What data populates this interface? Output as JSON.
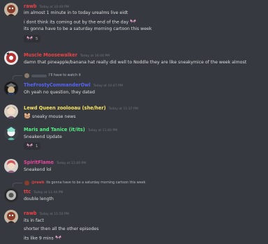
{
  "messages": [
    {
      "author": "rawb",
      "timestamp": "Today at 10:40 PM",
      "color": "#ed4245",
      "lines": [
        "im almost 1 minute in to today urealms live eidt",
        "i dont think its coming out by the end of the day",
        "its gonna have to be a saturday morning cartoon this week"
      ],
      "reaction": {
        "count": "5",
        "emoji": "butterfly-icon"
      }
    },
    {
      "author": "Muscle Moosewalker",
      "timestamp": "Today at 10:44 PM",
      "color": "#ed4245",
      "lines": [
        "damn that pineapple/banana hat really did well to Noddle they are like sneakymice of the week almost"
      ]
    },
    {
      "reply_preview": "I'll have to watch it",
      "author": "TheFrostyCommanderOwl",
      "timestamp": "Today at 10:47 PM",
      "color": "#5865f2",
      "lines": [
        "Oh yeah no question, they dated"
      ]
    },
    {
      "author": "Lewd Queen zoolooau (she/her)",
      "timestamp": "Today at 11:37 PM",
      "color": "#fee75c",
      "lines": [
        "sneaky mouse news"
      ]
    },
    {
      "author": "Maris and Tanice (it/its)",
      "timestamp": "Today at 11:40 PM",
      "color": "#57f287",
      "lines": [
        "Sneakend Update"
      ],
      "reaction": {
        "count": "1",
        "emoji": "butterfly-icon"
      }
    },
    {
      "author": "SpiritFlame",
      "timestamp": "Today at 11:40 PM",
      "color": "#eb459e",
      "lines": [
        "Sneakend lol"
      ]
    },
    {
      "reply_author": "@rawb",
      "reply_preview": "its gonna have to be a saturday morning cartoon this week",
      "author": "ttc",
      "timestamp": "Today at 11:44 PM",
      "color": "#ed4245",
      "lines": [
        "double length"
      ]
    },
    {
      "author": "rawb",
      "timestamp": "Today at 11:50 PM",
      "color": "#ed4245",
      "lines": [
        "its in fact",
        "shorter then all the other episodes",
        "its like 9 mins"
      ]
    }
  ]
}
